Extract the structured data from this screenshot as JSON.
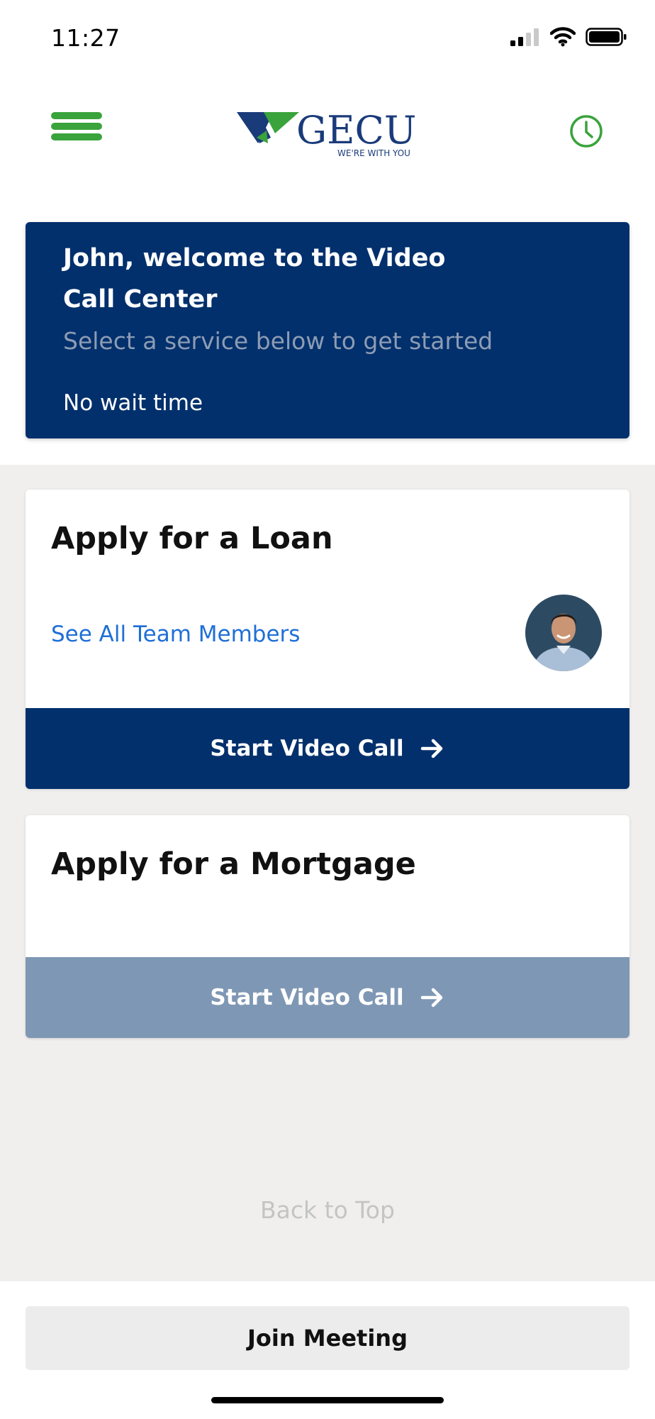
{
  "status_bar": {
    "time": "11:27"
  },
  "header": {
    "logo_text": "GECU",
    "logo_tagline": "WE'RE WITH YOU",
    "colors": {
      "green": "#3aa33c",
      "navy": "#1a3b7a"
    }
  },
  "welcome": {
    "title": "John, welcome to the Video Call Center",
    "subtitle": "Select a service below to get started",
    "wait_time": "No wait time",
    "background": "#02306c"
  },
  "services": [
    {
      "title": "Apply for a Loan",
      "team_link": "See All Team Members",
      "cta_label": "Start Video Call",
      "cta_state": "enabled"
    },
    {
      "title": "Apply for a Mortgage",
      "cta_label": "Start Video Call",
      "cta_state": "disabled"
    }
  ],
  "footer": {
    "back_to_top": "Back to Top",
    "join_meeting": "Join Meeting"
  }
}
